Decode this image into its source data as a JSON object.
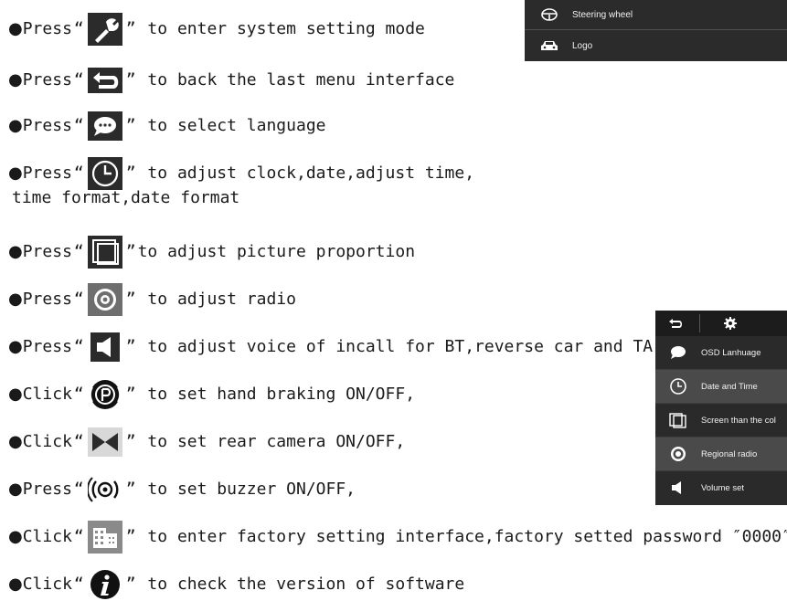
{
  "bullet": "●",
  "open_quote": "“",
  "close_quote": "”",
  "lines": [
    {
      "verb": "Press",
      "icon": "settings-tool-icon",
      "text": " to enter system setting mode"
    },
    {
      "verb": "Press",
      "icon": "back-arrow-icon",
      "text": " to back the last menu interface"
    },
    {
      "verb": "Press",
      "icon": "speech-bubble-icon",
      "text": " to select language"
    },
    {
      "verb": "Press",
      "icon": "clock-icon",
      "text": " to adjust clock,date,adjust time,",
      "continuation": "time format,date format"
    },
    {
      "verb": "Press",
      "icon": "screen-ratio-icon",
      "text": "to adjust picture proportion"
    },
    {
      "verb": "Press",
      "icon": "radio-icon",
      "text": " to adjust radio"
    },
    {
      "verb": "Press",
      "icon": "speaker-icon",
      "text": " to adjust voice of incall for BT,reverse car and TA"
    },
    {
      "verb": "Click",
      "icon": "parking-brake-icon",
      "text": " to set hand braking ON/OFF,"
    },
    {
      "verb": "Click",
      "icon": "rear-camera-icon",
      "text": " to set rear camera ON/OFF,"
    },
    {
      "verb": "Press",
      "icon": "buzzer-icon",
      "text": " to set buzzer ON/OFF,"
    },
    {
      "verb": "Click",
      "icon": "factory-building-icon",
      "text": " to enter factory setting interface,factory setted password ″0000″"
    },
    {
      "verb": "Click",
      "icon": "info-icon",
      "text": " to check the version of software"
    }
  ],
  "top_panel": {
    "items": [
      {
        "label": "Steering wheel",
        "icon": "steering-wheel-icon"
      },
      {
        "label": "Logo",
        "icon": "car-icon"
      }
    ]
  },
  "menu_panel": {
    "header_icons": [
      "back-arrow-icon",
      "gear-icon"
    ],
    "items": [
      {
        "label": "OSD Lanhuage",
        "icon": "speech-bubble-icon",
        "highlighted": false
      },
      {
        "label": "Date and Time",
        "icon": "clock-icon",
        "highlighted": true
      },
      {
        "label": "Screen than the col",
        "icon": "screen-ratio-icon",
        "highlighted": false
      },
      {
        "label": "Regional radio",
        "icon": "radio-icon",
        "highlighted": true
      },
      {
        "label": "Volume set",
        "icon": "speaker-icon",
        "highlighted": false
      }
    ]
  }
}
